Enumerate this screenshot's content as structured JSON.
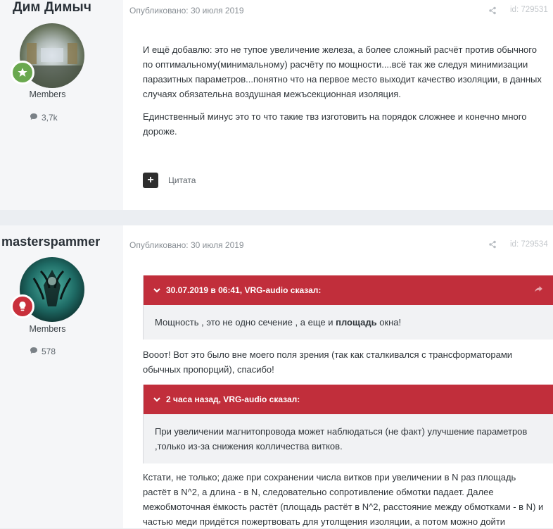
{
  "posts": [
    {
      "author": "Дим Димыч",
      "group": "Members",
      "post_count": "3,7k",
      "published": "Опубликовано: 30 июля 2019",
      "post_id": "id: 729531",
      "paragraphs": [
        "И ещё добавлю: это не тупое увеличение железа, а более сложный расчёт против обычного по оптимальному(минимальному) расчёту по мощности....всё так же следуя минимизации паразитных параметров...понятно что на первое место выходит качество изоляции, в данных случаях обязательна воздушная межъсекционная изоляция.",
        "Единственный минус это то что такие твз изготовить на порядок сложнее и конечно много дороже."
      ],
      "quote_button": "Цитата"
    },
    {
      "author": "masterspammer",
      "group": "Members",
      "post_count": "578",
      "published": "Опубликовано: 30 июля 2019",
      "post_id": "id: 729534",
      "quote1": {
        "header": "30.07.2019 в 06:41, VRG-audio сказал:",
        "text_before": "Мощность , это не одно сечение , а еще и ",
        "text_bold": "площадь",
        "text_after": " окна!"
      },
      "reply1": "Вооот! Вот это было вне моего поля зрения (так как сталкивался с трансформаторами обычных пропорций), спасибо!",
      "quote2": {
        "header": "2 часа назад, VRG-audio сказал:",
        "text": "При увеличении магнитопровода может наблюдаться (не факт) улучшение параметров ,только  из-за снижения колличества витков."
      },
      "reply2": "Кстати, не только; даже при сохранении числа витков при увеличении в N раз площадь растёт в N^2, а длина - в N, следовательно сопротивление обмотки падает. Далее межобмоточная ёмкость растёт (площадь растёт в N^2, расстояние между обмотками - в N) и частью меди придётся пожертвовать для утолщения изоляции, а потом можно дойти"
    }
  ],
  "colors": {
    "quote_header": "#c12e3b",
    "badge_green": "#6aa84f",
    "badge_red": "#c9303c"
  }
}
